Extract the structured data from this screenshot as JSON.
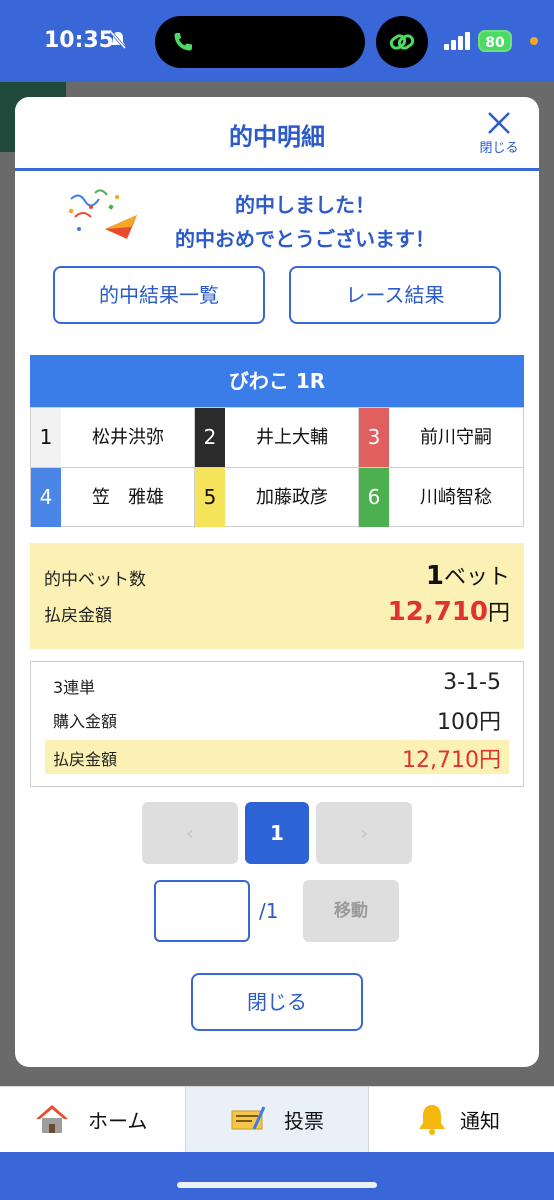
{
  "status_bar": {
    "time": "10:35",
    "battery": "80"
  },
  "modal": {
    "title": "的中明細",
    "close_label": "閉じる",
    "congrats_line1": "的中しました！",
    "congrats_line2": "的中おめでとうございます！",
    "hit_list_button": "的中結果一覧",
    "race_result_button": "レース結果",
    "race_header": "びわこ 1R",
    "racers": [
      {
        "num": "1",
        "name": "松井洪弥",
        "bg": "#f2f2f2",
        "fg": "#111111"
      },
      {
        "num": "2",
        "name": "井上大輔",
        "bg": "#2b2b2b",
        "fg": "#ffffff"
      },
      {
        "num": "3",
        "name": "前川守嗣",
        "bg": "#e06060",
        "fg": "#ffffff"
      },
      {
        "num": "4",
        "name": "笠　雅雄",
        "bg": "#4a86e8",
        "fg": "#ffffff"
      },
      {
        "num": "5",
        "name": "加藤政彦",
        "bg": "#f5e35a",
        "fg": "#111111"
      },
      {
        "num": "6",
        "name": "川崎智稔",
        "bg": "#4caf50",
        "fg": "#ffffff"
      }
    ],
    "summary": {
      "bets_label": "的中ベット数",
      "bets_value": "1",
      "bets_unit": "ベット",
      "payout_label": "払戻金額",
      "payout_value": "12,710",
      "payout_unit": "円"
    },
    "detail": {
      "bet_type_label": "3連単",
      "bet_type_value": "3-1-5",
      "purchase_label": "購入金額",
      "purchase_value": "100円",
      "payout_label": "払戻金額",
      "payout_value": "12,710円"
    },
    "pagination": {
      "prev": "‹",
      "current": "1",
      "next": "›",
      "input_value": "",
      "total": "/1",
      "move_button": "移動"
    },
    "close_button": "閉じる"
  },
  "bottom_nav": {
    "home": "ホーム",
    "vote": "投票",
    "notice": "通知",
    "active": "vote"
  }
}
